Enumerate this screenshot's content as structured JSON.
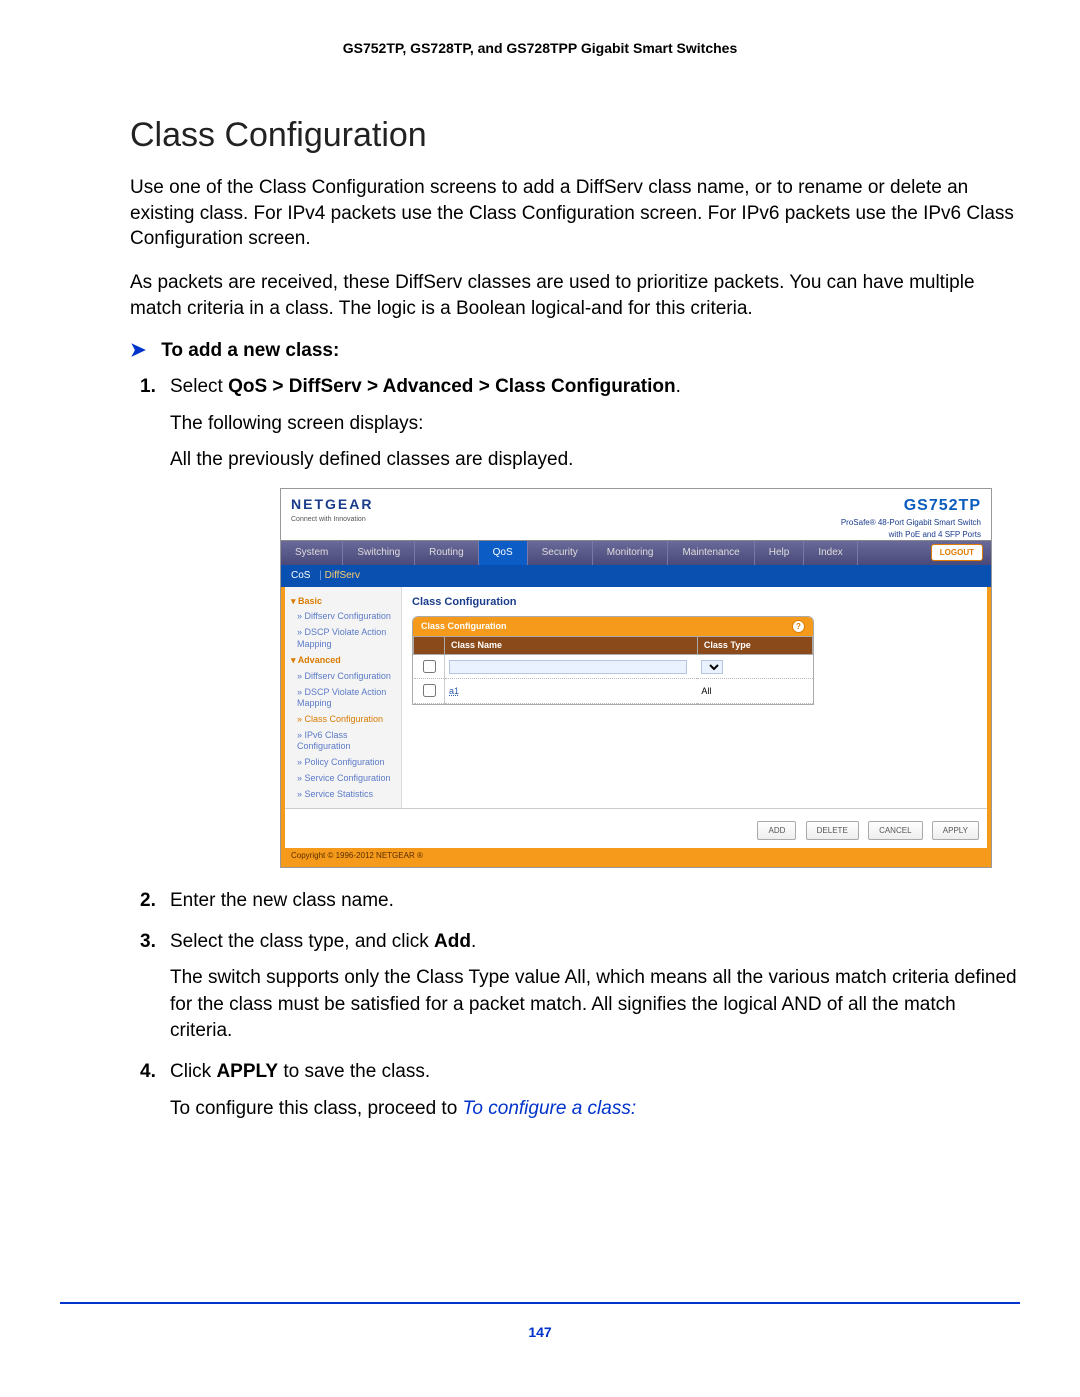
{
  "doc_header": "GS752TP, GS728TP, and GS728TPP Gigabit Smart Switches",
  "section_title": "Class Configuration",
  "para1": "Use one of the Class Configuration screens to add a DiffServ class name, or to rename or delete an existing class. For IPv4 packets use the Class Configuration screen. For IPv6 packets use the IPv6 Class Configuration screen.",
  "para2": "As packets are received, these DiffServ classes are used to prioritize packets. You can have multiple match criteria in a class. The logic is a Boolean logical-and for this criteria.",
  "proc_title": "To add a new class:",
  "steps": {
    "s1_pre": "Select ",
    "s1_path": "QoS > DiffServ > Advanced > Class Configuration",
    "s1_post": ".",
    "s1_sub1": "The following screen displays:",
    "s1_sub2": "All the previously defined classes are displayed.",
    "s2": "Enter the new class name.",
    "s3_a": "Select the class type, and click ",
    "s3_b": "Add",
    "s3_c": ".",
    "s3_sub": "The switch supports only the Class Type value All, which means all the various match criteria defined for the class must be satisfied for a packet match. All signifies the logical AND of all the match criteria.",
    "s4_a": "Click ",
    "s4_b": "APPLY",
    "s4_c": " to save the class.",
    "s4_sub_a": "To configure this class, proceed to ",
    "s4_sub_link": "To configure a class:"
  },
  "shot": {
    "logo": "NETGEAR",
    "logo_sub": "Connect with Innovation",
    "prod_model": "GS752TP",
    "prod_desc1": "ProSafe® 48-Port Gigabit Smart Switch",
    "prod_desc2": "with PoE and 4 SFP Ports",
    "tabs": [
      "System",
      "Switching",
      "Routing",
      "QoS",
      "Security",
      "Monitoring",
      "Maintenance",
      "Help",
      "Index"
    ],
    "active_tab": "QoS",
    "logout": "LOGOUT",
    "subtab1": "CoS",
    "subtab2": "DiffServ",
    "sidebar": {
      "basic": "Basic",
      "basic_items": [
        "Diffserv Configuration",
        "DSCP Violate Action Mapping"
      ],
      "adv": "Advanced",
      "adv_items": [
        "Diffserv Configuration",
        "DSCP Violate Action Mapping",
        "Class Configuration",
        "IPv6 Class Configuration",
        "Policy Configuration",
        "Service Configuration",
        "Service Statistics"
      ]
    },
    "panel_title": "Class Configuration",
    "box_title": "Class Configuration",
    "col_classname": "Class Name",
    "col_classtype": "Class Type",
    "row_a1": "a1",
    "row_all": "All",
    "buttons": [
      "ADD",
      "DELETE",
      "CANCEL",
      "APPLY"
    ],
    "copyright": "Copyright © 1996-2012 NETGEAR ®"
  },
  "page_num": "147"
}
